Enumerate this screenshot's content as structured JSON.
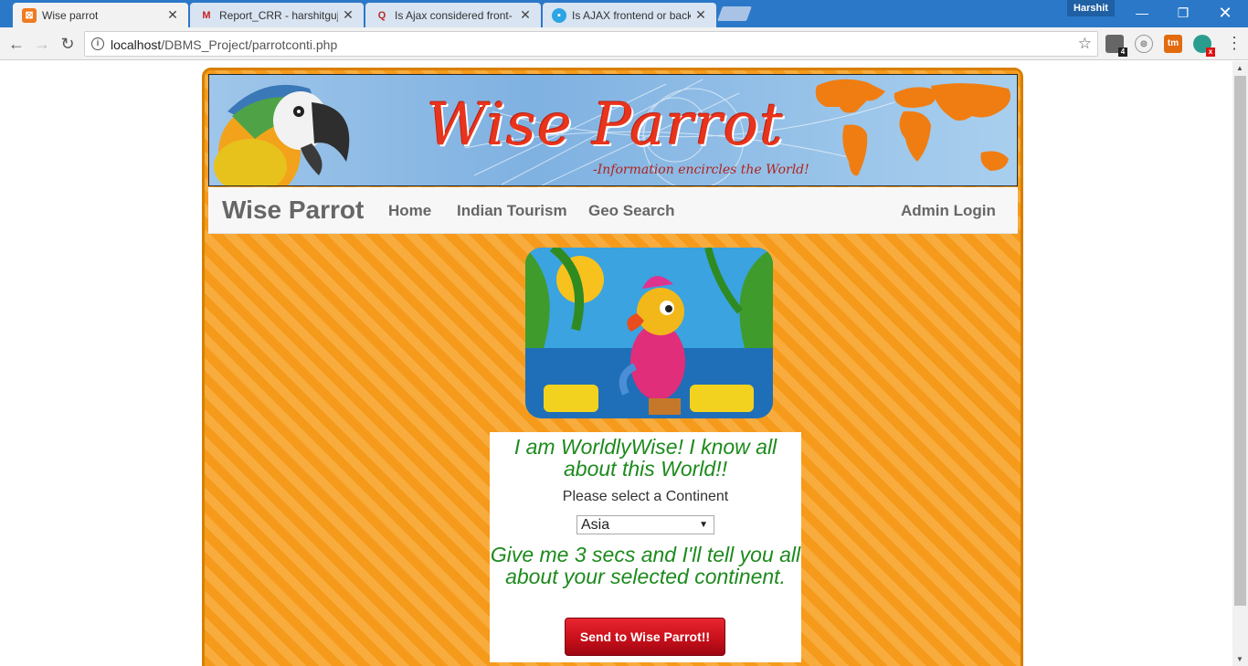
{
  "browser": {
    "tabs": [
      {
        "title": "Wise parrot",
        "favicon": "xampp-icon",
        "active": true
      },
      {
        "title": "Report_CRR - harshitguj",
        "favicon": "gmail-icon",
        "active": false
      },
      {
        "title": "Is Ajax considered front-",
        "favicon": "quora-icon",
        "active": false
      },
      {
        "title": "Is AJAX frontend or back",
        "favicon": "chat-bubble-icon",
        "active": false
      }
    ],
    "profile_name": "Harshit",
    "url_host": "localhost",
    "url_path": "/DBMS_Project/parrotconti.php",
    "extension_badges": {
      "first": "4",
      "last": "x"
    }
  },
  "site": {
    "banner_title": "Wise Parrot",
    "banner_tagline": "-Information encircles the World!",
    "brand": "Wise Parrot",
    "nav": [
      "Home",
      "Indian Tourism",
      "Geo Search"
    ],
    "admin_login": "Admin Login"
  },
  "card": {
    "headline": "I am WorldlyWise! I know all about this World!!",
    "prompt": "Please select a Continent",
    "selected_continent": "Asia",
    "subline": "Give me 3 secs and I'll tell you all about your selected continent.",
    "button_label": "Send to Wise Parrot!!"
  },
  "colors": {
    "chrome_blue": "#2b78c8",
    "page_orange": "#f59a1b",
    "banner_title_red": "#e8341c",
    "green_text": "#1d8a1d",
    "button_red": "#c8101b"
  }
}
